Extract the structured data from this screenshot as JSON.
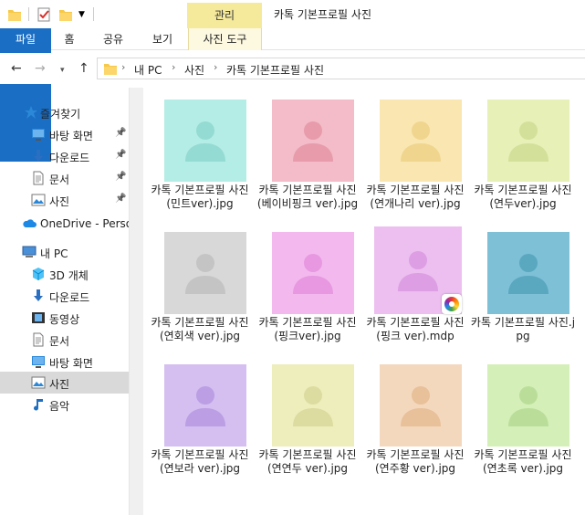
{
  "window": {
    "title": "카톡 기본프로필 사진",
    "context_tab_group": "관리"
  },
  "ribbon": {
    "tabs": [
      "파일",
      "홈",
      "공유",
      "보기",
      "사진 도구"
    ],
    "accent": "#1a6ec4",
    "context_color": "#f5e99c"
  },
  "address": {
    "crumbs": [
      "내 PC",
      "사진",
      "카톡 기본프로필 사진"
    ]
  },
  "sidebar": {
    "items": [
      {
        "label": "즐겨찾기",
        "icon": "star-icon"
      },
      {
        "label": "바탕 화면",
        "icon": "desktop-icon",
        "pinned": true
      },
      {
        "label": "다운로드",
        "icon": "download-icon",
        "pinned": true
      },
      {
        "label": "문서",
        "icon": "document-icon",
        "pinned": true
      },
      {
        "label": "사진",
        "icon": "picture-icon",
        "pinned": true
      },
      {
        "label": "OneDrive - Person",
        "icon": "cloud-icon"
      },
      {
        "label": "내 PC",
        "icon": "computer-icon"
      },
      {
        "label": "3D 개체",
        "icon": "cube-icon"
      },
      {
        "label": "다운로드",
        "icon": "download-icon"
      },
      {
        "label": "동영상",
        "icon": "film-icon"
      },
      {
        "label": "문서",
        "icon": "document-icon"
      },
      {
        "label": "바탕 화면",
        "icon": "desktop-icon"
      },
      {
        "label": "사진",
        "icon": "picture-icon",
        "selected": true
      },
      {
        "label": "음악",
        "icon": "music-icon"
      }
    ]
  },
  "files": [
    {
      "name": "카톡 기본프로필 사진(민트ver).jpg",
      "bg": "#b4ede6",
      "fg": "#94dbd3"
    },
    {
      "name": "카톡 기본프로필 사진(베이비핑크 ver).jpg",
      "bg": "#f3bcc8",
      "fg": "#e79bab"
    },
    {
      "name": "카톡 기본프로필 사진(연개나리 ver).jpg",
      "bg": "#fae6b0",
      "fg": "#f0d58f"
    },
    {
      "name": "카톡 기본프로필 사진(연두ver).jpg",
      "bg": "#e7f0b6",
      "fg": "#d3e09a"
    },
    {
      "name": "카톡 기본프로필 사진(연회색 ver).jpg",
      "bg": "#d8d8d8",
      "fg": "#c4c4c4"
    },
    {
      "name": "카톡 기본프로필 사진(핑크ver).jpg",
      "bg": "#f3b9ee",
      "fg": "#e798e0"
    },
    {
      "name": "카톡 기본프로필 사진(핑크 ver).mdp",
      "bg": "#ecbff0",
      "fg": "#dd9ee3",
      "badge": "medibang-icon"
    },
    {
      "name": "카톡 기본프로필 사진.jpg",
      "bg": "#7ec0d6",
      "fg": "#5aa7c0"
    },
    {
      "name": "카톡 기본프로필 사진(연보라 ver).jpg",
      "bg": "#d4bff0",
      "fg": "#bb9ee3"
    },
    {
      "name": "카톡 기본프로필 사진(연연두 ver).jpg",
      "bg": "#eeeebc",
      "fg": "#dcdca0"
    },
    {
      "name": "카톡 기본프로필 사진(연주황 ver).jpg",
      "bg": "#f4d8bd",
      "fg": "#e8c09a"
    },
    {
      "name": "카톡 기본프로필 사진(연초록 ver).jpg",
      "bg": "#d4f0b8",
      "fg": "#bade9a"
    }
  ]
}
